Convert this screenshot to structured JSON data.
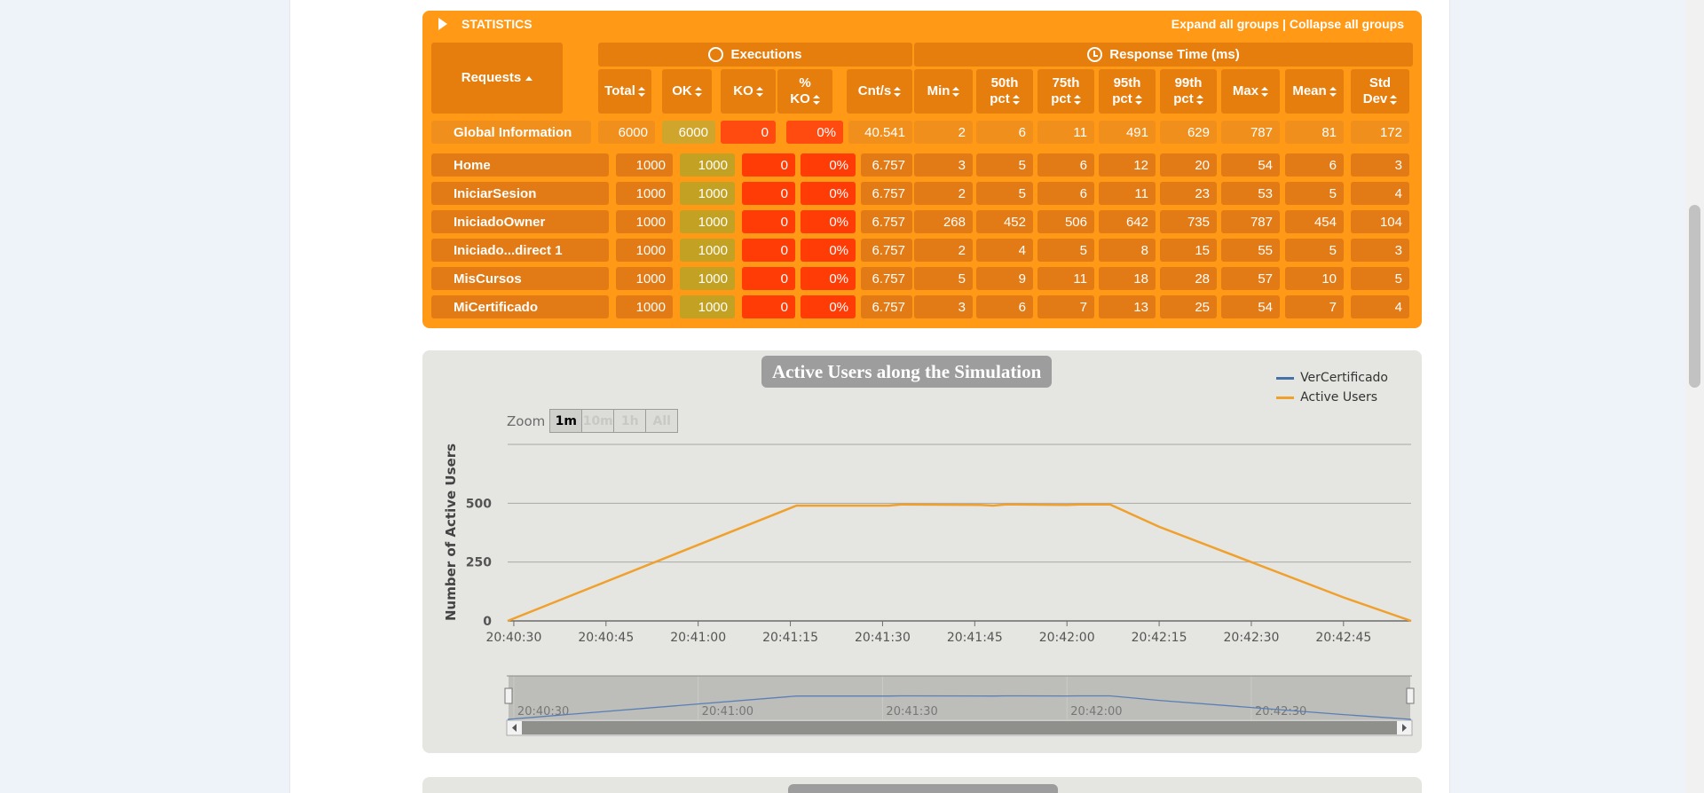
{
  "statistics": {
    "title": "STATISTICS",
    "expand_label": "Expand all groups",
    "separator": " | ",
    "collapse_label": "Collapse all groups",
    "headers": {
      "requests": "Requests",
      "executions": "Executions",
      "response_time": "Response Time (ms)",
      "total": "Total",
      "ok": "OK",
      "ko": "KO",
      "pct_ko_line1": "%",
      "pct_ko_line2": "KO",
      "cnt_s": "Cnt/s",
      "min": "Min",
      "p50_line1": "50th",
      "p50_line2": "pct",
      "p75_line1": "75th",
      "p75_line2": "pct",
      "p95_line1": "95th",
      "p95_line2": "pct",
      "p99_line1": "99th",
      "p99_line2": "pct",
      "max": "Max",
      "mean": "Mean",
      "std_line1": "Std",
      "std_line2": "Dev"
    },
    "global": {
      "name": "Global Information",
      "total": "6000",
      "ok": "6000",
      "ko": "0",
      "pct_ko": "0%",
      "cnt_s": "40.541",
      "min": "2",
      "p50": "6",
      "p75": "11",
      "p95": "491",
      "p99": "629",
      "max": "787",
      "mean": "81",
      "std": "172"
    },
    "rows": [
      {
        "name": "Home",
        "total": "1000",
        "ok": "1000",
        "ko": "0",
        "pct_ko": "0%",
        "cnt_s": "6.757",
        "min": "3",
        "p50": "5",
        "p75": "6",
        "p95": "12",
        "p99": "20",
        "max": "54",
        "mean": "6",
        "std": "3"
      },
      {
        "name": "IniciarSesion",
        "total": "1000",
        "ok": "1000",
        "ko": "0",
        "pct_ko": "0%",
        "cnt_s": "6.757",
        "min": "2",
        "p50": "5",
        "p75": "6",
        "p95": "11",
        "p99": "23",
        "max": "53",
        "mean": "5",
        "std": "4"
      },
      {
        "name": "IniciadoOwner",
        "total": "1000",
        "ok": "1000",
        "ko": "0",
        "pct_ko": "0%",
        "cnt_s": "6.757",
        "min": "268",
        "p50": "452",
        "p75": "506",
        "p95": "642",
        "p99": "735",
        "max": "787",
        "mean": "454",
        "std": "104"
      },
      {
        "name": "Iniciado...direct 1",
        "total": "1000",
        "ok": "1000",
        "ko": "0",
        "pct_ko": "0%",
        "cnt_s": "6.757",
        "min": "2",
        "p50": "4",
        "p75": "5",
        "p95": "8",
        "p99": "15",
        "max": "55",
        "mean": "5",
        "std": "3"
      },
      {
        "name": "MisCursos",
        "total": "1000",
        "ok": "1000",
        "ko": "0",
        "pct_ko": "0%",
        "cnt_s": "6.757",
        "min": "5",
        "p50": "9",
        "p75": "11",
        "p95": "18",
        "p99": "28",
        "max": "57",
        "mean": "10",
        "std": "5"
      },
      {
        "name": "MiCertificado",
        "total": "1000",
        "ok": "1000",
        "ko": "0",
        "pct_ko": "0%",
        "cnt_s": "6.757",
        "min": "3",
        "p50": "6",
        "p75": "7",
        "p95": "13",
        "p99": "25",
        "max": "54",
        "mean": "7",
        "std": "4"
      }
    ]
  },
  "chart_data": {
    "type": "line",
    "title": "Active Users along the Simulation",
    "ylabel": "Number of Active Users",
    "xlabel": "",
    "ylim": [
      0,
      750
    ],
    "yticks": [
      0,
      250,
      500
    ],
    "xticks": [
      "20:40:30",
      "20:40:45",
      "20:41:00",
      "20:41:15",
      "20:41:30",
      "20:41:45",
      "20:42:00",
      "20:42:15",
      "20:42:30",
      "20:42:45"
    ],
    "x_range": [
      "20:40:29",
      "20:42:56"
    ],
    "navigator_ticks": [
      "20:40:30",
      "20:41:00",
      "20:41:30",
      "20:42:00",
      "20:42:30"
    ],
    "legend_position": "top-right",
    "zoom_label": "Zoom",
    "zoom_buttons": [
      "1m",
      "10m",
      "1h",
      "All"
    ],
    "zoom_active": "1m",
    "series": [
      {
        "name": "VerCertificado",
        "color": "#4572a7",
        "points": []
      },
      {
        "name": "Active Users",
        "color": "#f0a02c",
        "points": [
          [
            "20:40:29",
            0
          ],
          [
            "20:41:16",
            490
          ],
          [
            "20:41:31",
            490
          ],
          [
            "20:41:33",
            495
          ],
          [
            "20:41:46",
            493
          ],
          [
            "20:41:48",
            490
          ],
          [
            "20:41:50",
            495
          ],
          [
            "20:42:00",
            493
          ],
          [
            "20:42:02",
            495
          ],
          [
            "20:42:07",
            495
          ],
          [
            "20:42:15",
            400
          ],
          [
            "20:42:30",
            250
          ],
          [
            "20:42:45",
            100
          ],
          [
            "20:42:56",
            0
          ]
        ]
      }
    ]
  }
}
